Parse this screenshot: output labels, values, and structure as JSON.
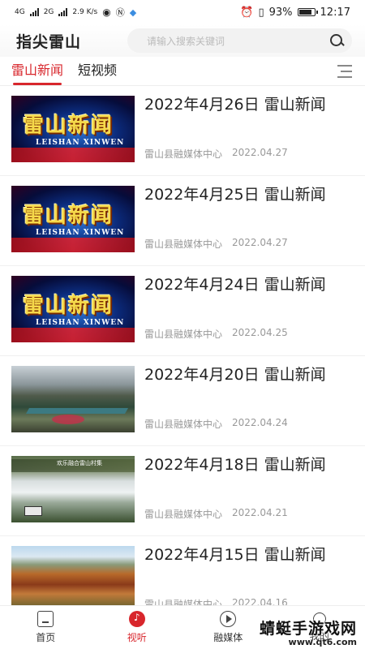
{
  "status_bar": {
    "network": "4G",
    "network2": "2G",
    "speed": "2.9 K/s",
    "battery": "93%",
    "time": "12:17"
  },
  "header": {
    "logo": "指尖雷山",
    "search_placeholder": "请输入搜索关键词"
  },
  "tabs": [
    {
      "label": "雷山新闻",
      "active": true
    },
    {
      "label": "短视频",
      "active": false
    }
  ],
  "thumbnail_text": {
    "cn": "雷山新闻",
    "en": "LEISHAN XINWEN",
    "falls_caption": "欢乐融合雷山村集"
  },
  "news_items": [
    {
      "title": "2022年4月26日 雷山新闻",
      "source": "雷山县融媒体中心",
      "date": "2022.04.27",
      "thumb": "news"
    },
    {
      "title": "2022年4月25日 雷山新闻",
      "source": "雷山县融媒体中心",
      "date": "2022.04.27",
      "thumb": "news"
    },
    {
      "title": "2022年4月24日 雷山新闻",
      "source": "雷山县融媒体中心",
      "date": "2022.04.25",
      "thumb": "news"
    },
    {
      "title": "2022年4月20日 雷山新闻",
      "source": "雷山县融媒体中心",
      "date": "2022.04.24",
      "thumb": "town"
    },
    {
      "title": "2022年4月18日 雷山新闻",
      "source": "雷山县融媒体中心",
      "date": "2022.04.21",
      "thumb": "falls"
    },
    {
      "title": "2022年4月15日 雷山新闻",
      "source": "雷山县融媒体中心",
      "date": "2022.04.16",
      "thumb": "village"
    }
  ],
  "bottom_nav": [
    {
      "label": "首页",
      "icon": "home-icon",
      "active": false
    },
    {
      "label": "视听",
      "icon": "listen-icon",
      "active": true
    },
    {
      "label": "融媒体",
      "icon": "media-play-icon",
      "active": false
    },
    {
      "label": "我的",
      "icon": "profile-icon",
      "active": false
    }
  ],
  "watermark": {
    "cn": "蜻蜓手游戏网",
    "url": "www.qt6.com"
  },
  "colors": {
    "accent": "#d8262c",
    "text": "#222222",
    "meta": "#999999"
  }
}
